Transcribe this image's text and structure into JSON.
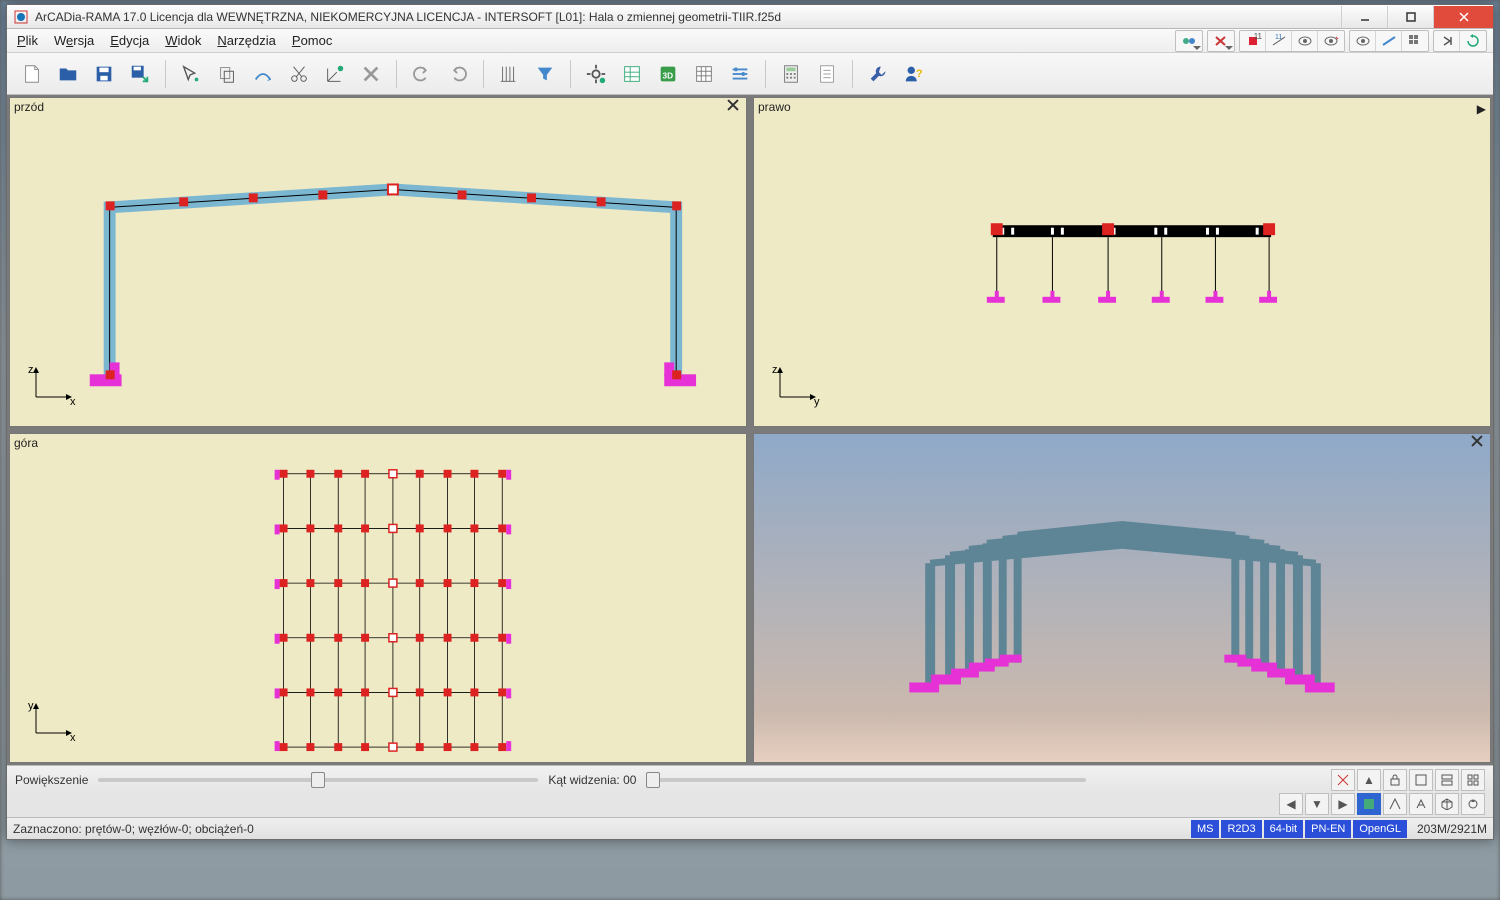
{
  "titlebar": {
    "title": "ArCADia-RAMA 17.0 Licencja dla WEWNĘTRZNA, NIEKOMERCYJNA LICENCJA - INTERSOFT [L01]: Hala o zmiennej geometrii-TIIR.f25d"
  },
  "menu": {
    "file": "Plik",
    "version": "Wersja",
    "edit": "Edycja",
    "view": "Widok",
    "tools": "Narzędzia",
    "help": "Pomoc"
  },
  "viewports": {
    "front": "przód",
    "right": "prawo",
    "top": "góra",
    "axis_x": "x",
    "axis_y": "y",
    "axis_z": "z"
  },
  "bottombar": {
    "zoom_label": "Powiększenie",
    "fov_label": "Kąt widzenia:",
    "fov_value": "00"
  },
  "statusbar": {
    "selection": "Zaznaczono: prętów-0; węzłów-0; obciążeń-0",
    "badge_ms": "MS",
    "badge_r2d3": "R2D3",
    "badge_64": "64-bit",
    "badge_pn": "PN-EN",
    "badge_gl": "OpenGL",
    "memory": "203M/2921M"
  }
}
